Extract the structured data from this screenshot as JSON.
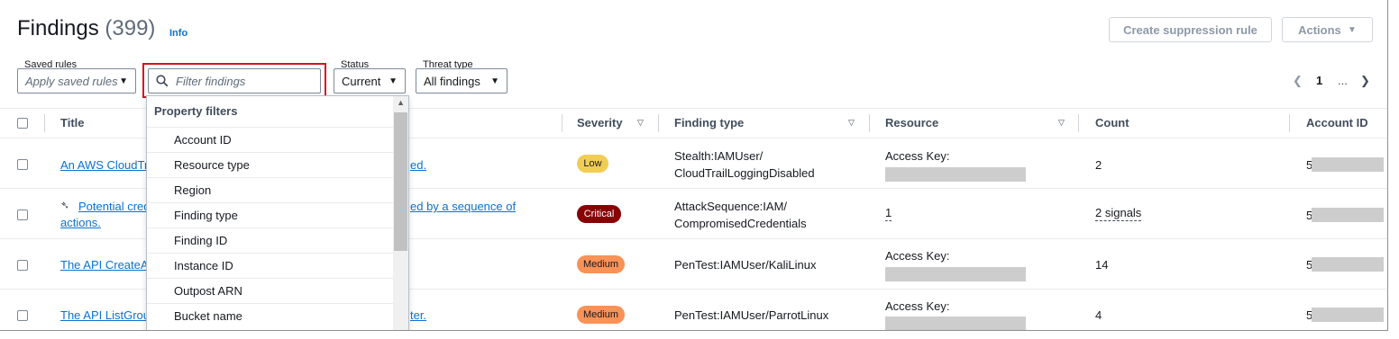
{
  "header": {
    "title": "Findings",
    "count": "(399)",
    "info_link": "Info",
    "create_suppression": "Create suppression rule",
    "actions": "Actions"
  },
  "filters": {
    "saved_rules_label": "Saved rules",
    "saved_rules_placeholder": "Apply saved rules",
    "search_placeholder": "Filter findings",
    "status_label": "Status",
    "status_value": "Current",
    "threat_label": "Threat type",
    "threat_value": "All findings"
  },
  "pagination": {
    "current_page": "1",
    "ellipsis": "..."
  },
  "table": {
    "columns": {
      "title": "Title",
      "severity": "Severity",
      "finding_type": "Finding type",
      "resource": "Resource",
      "count": "Count",
      "account_id": "Account ID"
    },
    "rows": [
      {
        "title_start": "An AWS CloudTra",
        "title_end": "ed.",
        "severity": "Low",
        "type_line1": "Stealth:IAMUser/",
        "type_line2": "CloudTrailLoggingDisabled",
        "resource": "Access Key:",
        "count": "2",
        "account_prefix": "5"
      },
      {
        "title_start": "Potential cred",
        "title_end": "ed by a sequence of",
        "title_line2": "actions.",
        "severity": "Critical",
        "type_line1": "AttackSequence:IAM/",
        "type_line2": "CompromisedCredentials",
        "resource": "1",
        "count": "2 signals",
        "account_prefix": "5"
      },
      {
        "title_start": "The API CreateAc",
        "severity": "Medium",
        "type_line1": "PenTest:IAMUser/KaliLinux",
        "resource": "Access Key:",
        "count": "14",
        "account_prefix": "5"
      },
      {
        "title_start": "The API ListGrou",
        "title_end": "ter.",
        "severity": "Medium",
        "type_line1": "PenTest:IAMUser/ParrotLinux",
        "resource": "Access Key:",
        "count": "4",
        "account_prefix": "5"
      }
    ]
  },
  "dropdown": {
    "heading": "Property filters",
    "items": [
      "Account ID",
      "Resource type",
      "Region",
      "Finding type",
      "Finding ID",
      "Instance ID",
      "Outpost ARN",
      "Bucket name"
    ]
  },
  "colors": {
    "low": "#f2cd54",
    "critical": "#870303",
    "medium": "#f89256",
    "link": "#0972d3",
    "highlight_border": "#d5141b"
  }
}
